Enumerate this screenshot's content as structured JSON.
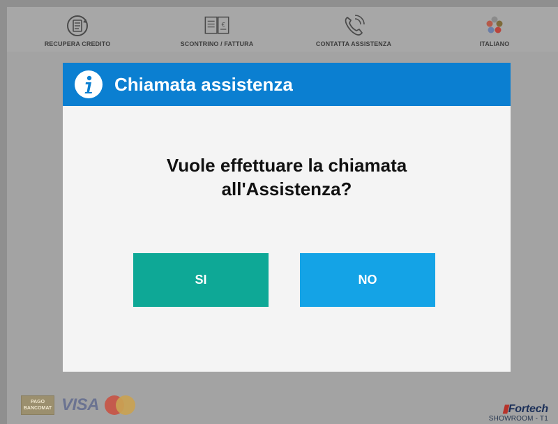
{
  "topbar": {
    "items": [
      {
        "label": "RECUPERA CREDITO",
        "icon": "credit-recovery-icon"
      },
      {
        "label": "SCONTRINO / FATTURA",
        "icon": "receipt-icon"
      },
      {
        "label": "CONTATTA ASSISTENZA",
        "icon": "phone-icon"
      },
      {
        "label": "ITALIANO",
        "icon": "language-flags-icon"
      }
    ]
  },
  "dialog": {
    "title": "Chiamata assistenza",
    "question_line1": "Vuole effettuare la chiamata",
    "question_line2": "all'Assistenza?",
    "yes_label": "SI",
    "no_label": "NO",
    "header_color": "#0b7fd1",
    "yes_color": "#0ea896",
    "no_color": "#14a3e6"
  },
  "footer": {
    "bancomat_line1": "PAGO",
    "bancomat_line2": "BANCOMAT",
    "visa": "VISA",
    "brand": "Fortech",
    "station": "SHOWROOM - T1"
  }
}
